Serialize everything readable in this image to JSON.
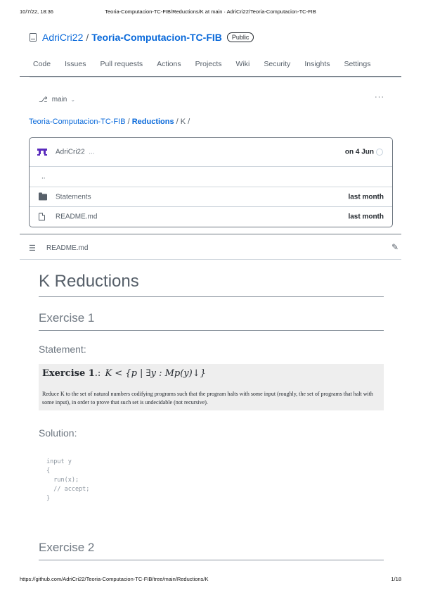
{
  "print": {
    "date": "10/7/22, 18:36",
    "title": "Teoria-Computacion-TC-FIB/Reductions/K at main · AdriCri22/Teoria-Computacion-TC-FIB",
    "url": "https://github.com/AdriCri22/Teoria-Computacion-TC-FIB/tree/main/Reductions/K",
    "page": "1/18"
  },
  "repo": {
    "owner": "AdriCri22",
    "separator": "/",
    "name": "Teoria-Computacion-TC-FIB",
    "visibility": "Public"
  },
  "nav": {
    "items": [
      "Code",
      "Issues",
      "Pull requests",
      "Actions",
      "Projects",
      "Wiki",
      "Security",
      "Insights",
      "Settings"
    ]
  },
  "branch": {
    "name": "main",
    "more": "···"
  },
  "breadcrumb": {
    "repo": "Teoria-Computacion-TC-FIB",
    "sep1": " / ",
    "dir": "Reductions",
    "rest": " / K /"
  },
  "files": {
    "commit": {
      "author": "AdriCri22",
      "message": "...",
      "time": "on 4 Jun"
    },
    "parent": "..",
    "rows": [
      {
        "icon": "folder-icon",
        "name": "Statements",
        "time": "last month"
      },
      {
        "icon": "file-icon",
        "name": "README.md",
        "time": "last month"
      }
    ]
  },
  "readme": {
    "filename": "README.md",
    "h1": "K Reductions",
    "exercise1": "Exercise 1",
    "statement": "Statement:",
    "math_title": "Exercise 1",
    "math_suffix": ".:",
    "math_formula": "K  <  {p | ∃y : Mp(y)↓}",
    "math_text": "Reduce K to the set of natural numbers codifying programs such that the program halts with some input (roughly, the set of programs that halt with some input), in order to prove that such set is undecidable (not recursive).",
    "solution": "Solution:",
    "code": "input y\n{\n  run(x);\n  // accept;\n}",
    "exercise2": "Exercise 2"
  }
}
